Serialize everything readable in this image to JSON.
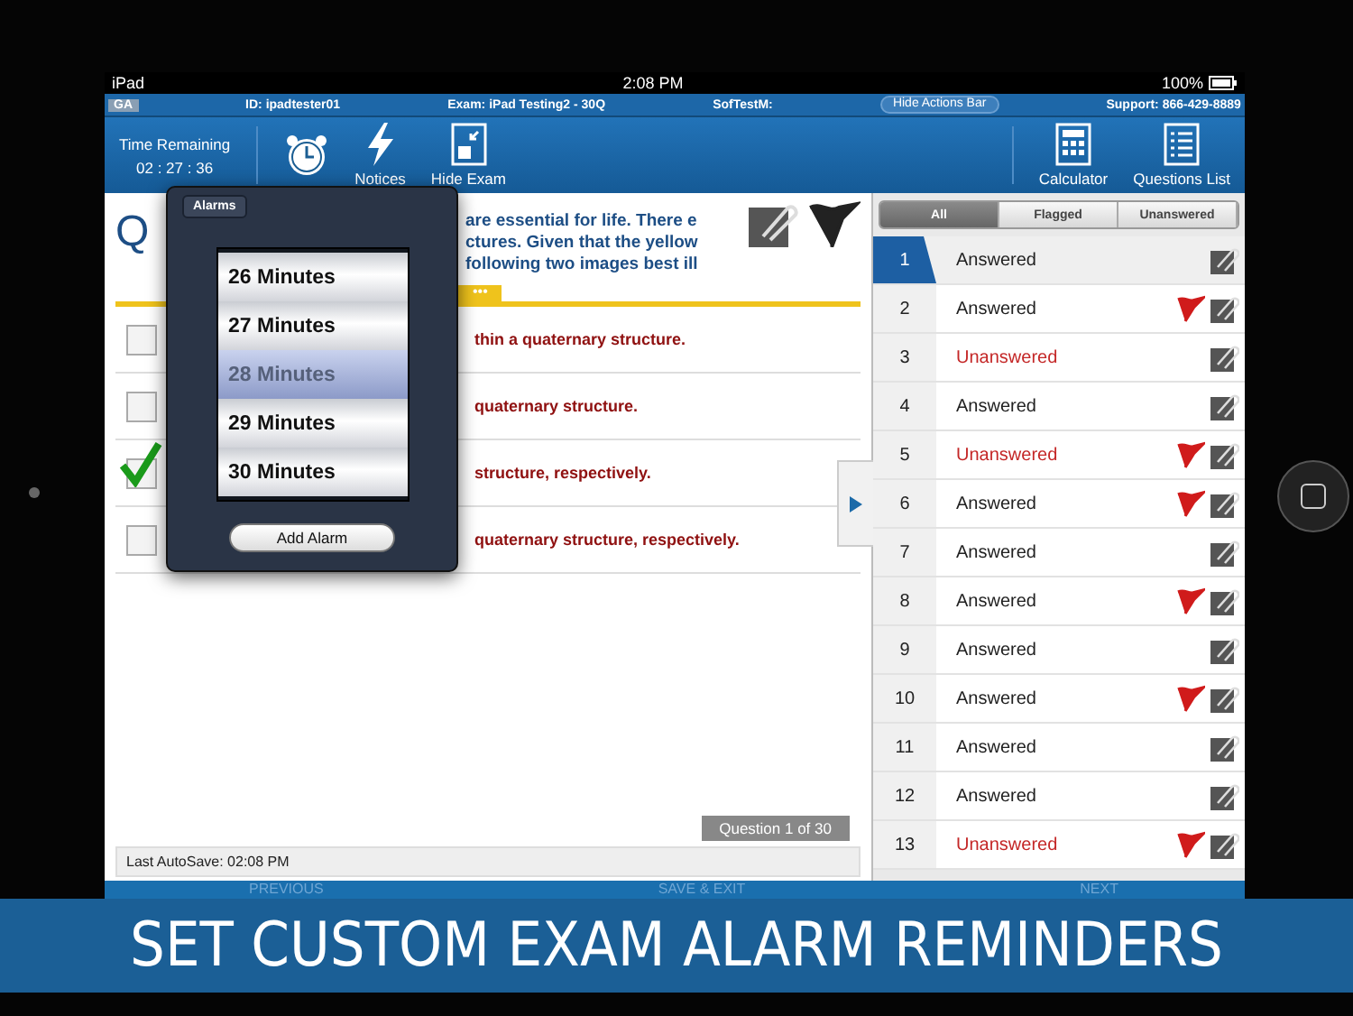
{
  "status_bar": {
    "device": "iPad",
    "time": "2:08 PM",
    "battery": "100%"
  },
  "info_bar": {
    "badge": "GA",
    "id": "ID: ipadtester01",
    "exam": "Exam: iPad Testing2 - 30Q",
    "org": "SofTestM:",
    "hide_button": "Hide Actions Bar",
    "support": "Support: 866-429-8889"
  },
  "toolbar": {
    "time_label": "Time Remaining",
    "time_value": "02 : 27 : 36",
    "left_tools": [
      {
        "kind": "alarm"
      },
      {
        "kind": "bolt",
        "label": "Notices"
      },
      {
        "kind": "hide",
        "label": "Hide Exam"
      }
    ],
    "right_tools": [
      {
        "kind": "calculator",
        "label": "Calculator"
      },
      {
        "kind": "list",
        "label": "Questions List"
      }
    ]
  },
  "question": {
    "number": "Q",
    "lines": [
      "are essential for life. There e",
      "ctures. Given that the yellow",
      "following two images best ill"
    ],
    "more": "•••",
    "options": [
      {
        "text": "thin a quaternary structure.",
        "checked": false
      },
      {
        "text": "quaternary structure.",
        "checked": false
      },
      {
        "text": "structure, respectively.",
        "checked": true
      },
      {
        "text": "quaternary structure, respectively.",
        "checked": false
      }
    ],
    "counter": "Question 1 of 30",
    "autosave": "Last AutoSave: 02:08 PM"
  },
  "alarms_popover": {
    "title": "Alarms",
    "items": [
      {
        "label": "26 Minutes",
        "selected": false
      },
      {
        "label": "27 Minutes",
        "selected": false
      },
      {
        "label": "28 Minutes",
        "selected": true
      },
      {
        "label": "29 Minutes",
        "selected": false
      },
      {
        "label": "30 Minutes",
        "selected": false
      }
    ],
    "button": "Add Alarm"
  },
  "questions_list": {
    "tabs": [
      {
        "label": "All",
        "selected": true
      },
      {
        "label": "Flagged",
        "selected": false
      },
      {
        "label": "Unanswered",
        "selected": false
      }
    ],
    "rows": [
      {
        "number": "1",
        "status": "Answered",
        "kind": "answered",
        "flagged": false,
        "selected": true
      },
      {
        "number": "2",
        "status": "Answered",
        "kind": "answered",
        "flagged": true,
        "selected": false
      },
      {
        "number": "3",
        "status": "Unanswered",
        "kind": "unanswered",
        "flagged": false,
        "selected": false
      },
      {
        "number": "4",
        "status": "Answered",
        "kind": "answered",
        "flagged": false,
        "selected": false
      },
      {
        "number": "5",
        "status": "Unanswered",
        "kind": "unanswered",
        "flagged": true,
        "selected": false
      },
      {
        "number": "6",
        "status": "Answered",
        "kind": "answered",
        "flagged": true,
        "selected": false
      },
      {
        "number": "7",
        "status": "Answered",
        "kind": "answered",
        "flagged": false,
        "selected": false
      },
      {
        "number": "8",
        "status": "Answered",
        "kind": "answered",
        "flagged": true,
        "selected": false
      },
      {
        "number": "9",
        "status": "Answered",
        "kind": "answered",
        "flagged": false,
        "selected": false
      },
      {
        "number": "10",
        "status": "Answered",
        "kind": "answered",
        "flagged": true,
        "selected": false
      },
      {
        "number": "11",
        "status": "Answered",
        "kind": "answered",
        "flagged": false,
        "selected": false
      },
      {
        "number": "12",
        "status": "Answered",
        "kind": "answered",
        "flagged": false,
        "selected": false
      },
      {
        "number": "13",
        "status": "Unanswered",
        "kind": "unanswered",
        "flagged": true,
        "selected": false
      }
    ]
  },
  "nav": {
    "previous": "PREVIOUS",
    "save": "SAVE & EXIT",
    "next": "NEXT"
  },
  "banner": "SET CUSTOM EXAM ALARM REMINDERS"
}
